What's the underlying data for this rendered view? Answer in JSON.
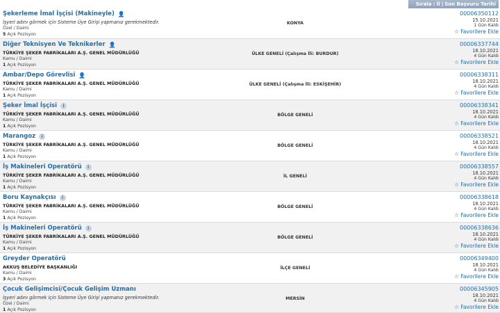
{
  "sort": {
    "label": "Sırala :",
    "option_il": "İl",
    "separator": "|",
    "option_deadline": "Son Başvuru Tarihi"
  },
  "jobs": [
    {
      "title": "Şekerleme İmal İşçisi (Makineyle)",
      "icon": "person-icon",
      "employer": "İşyeri adını görmek için Sisteme Üye Girişi yapmanız gerekmektedir.",
      "employer_hidden": true,
      "type": "Özel / Daimi",
      "positions_count": "5",
      "positions_label": "Açık Pozisyon",
      "location": "KONYA",
      "code": "00006350112",
      "date": "15.10.2021",
      "days_left": "1 Gün Kaldı",
      "fav": "Favorilere Ekle"
    },
    {
      "title": "Diğer Teknisyen Ve Teknikerler",
      "icon": "person-icon",
      "employer": "TÜRKİYE ŞEKER FABRİKALARI A.Ş. GENEL MÜDÜRLÜĞÜ",
      "employer_hidden": false,
      "type": "Kamu / Daimi",
      "positions_count": "1",
      "positions_label": "Açık Pozisyon",
      "location": "ÜLKE GENELİ (Çalışma İli: BURDUR)",
      "code": "00006337744",
      "date": "18.10.2021",
      "days_left": "4 Gün Kaldı",
      "fav": "Favorilere Ekle"
    },
    {
      "title": "Ambar/Depo Görevlisi",
      "icon": "person-icon",
      "employer": "TÜRKİYE ŞEKER FABRİKALARI A.Ş. GENEL MÜDÜRLÜĞÜ",
      "employer_hidden": false,
      "type": "Kamu / Daimi",
      "positions_count": "1",
      "positions_label": "Açık Pozisyon",
      "location": "ÜLKE GENELİ (Çalışma İli: ESKİŞEHİR)",
      "code": "00006338311",
      "date": "18.10.2021",
      "days_left": "4 Gün Kaldı",
      "fav": "Favorilere Ekle"
    },
    {
      "title": "Şeker İmal İşçisi",
      "icon": "info-icon",
      "employer": "TÜRKİYE ŞEKER FABRİKALARI A.Ş. GENEL MÜDÜRLÜĞÜ",
      "employer_hidden": false,
      "type": "Kamu / Daimi",
      "positions_count": "1",
      "positions_label": "Açık Pozisyon",
      "location": "BÖLGE GENELİ",
      "code": "00006338341",
      "date": "18.10.2021",
      "days_left": "4 Gün Kaldı",
      "fav": "Favorilere Ekle"
    },
    {
      "title": "Marangoz",
      "icon": "info-icon",
      "employer": "TÜRKİYE ŞEKER FABRİKALARI A.Ş. GENEL MÜDÜRLÜĞÜ",
      "employer_hidden": false,
      "type": "Kamu / Daimi",
      "positions_count": "1",
      "positions_label": "Açık Pozisyon",
      "location": "BÖLGE GENELİ",
      "code": "00006338521",
      "date": "18.10.2021",
      "days_left": "4 Gün Kaldı",
      "fav": "Favorilere Ekle"
    },
    {
      "title": "İş Makineleri Operatörü",
      "icon": "info-icon",
      "employer": "TÜRKİYE ŞEKER FABRİKALARI A.Ş. GENEL MÜDÜRLÜĞÜ",
      "employer_hidden": false,
      "type": "Kamu / Daimi",
      "positions_count": "1",
      "positions_label": "Açık Pozisyon",
      "location": "İL GENELİ",
      "code": "00006338557",
      "date": "18.10.2021",
      "days_left": "4 Gün Kaldı",
      "fav": "Favorilere Ekle"
    },
    {
      "title": "Boru Kaynakçısı",
      "icon": "info-icon",
      "employer": "TÜRKİYE ŞEKER FABRİKALARI A.Ş. GENEL MÜDÜRLÜĞÜ",
      "employer_hidden": false,
      "type": "Kamu / Daimi",
      "positions_count": "1",
      "positions_label": "Açık Pozisyon",
      "location": "BÖLGE GENELİ",
      "code": "00006338618",
      "date": "18.10.2021",
      "days_left": "4 Gün Kaldı",
      "fav": "Favorilere Ekle"
    },
    {
      "title": "İş Makineleri Operatörü",
      "icon": "info-icon",
      "employer": "TÜRKİYE ŞEKER FABRİKALARI A.Ş. GENEL MÜDÜRLÜĞÜ",
      "employer_hidden": false,
      "type": "Kamu / Daimi",
      "positions_count": "1",
      "positions_label": "Açık Pozisyon",
      "location": "BÖLGE GENELİ",
      "code": "00006338636",
      "date": "18.10.2021",
      "days_left": "4 Gün Kaldı",
      "fav": "Favorilere Ekle"
    },
    {
      "title": "Greyder Operatörü",
      "icon": "",
      "employer": "AKKUŞ BELEDİYE BAŞKANLIĞI",
      "employer_hidden": false,
      "type": "Kamu / Daimi",
      "positions_count": "3",
      "positions_label": "Açık Pozisyon",
      "location": "İLÇE GENELİ",
      "code": "00006349400",
      "date": "18.10.2021",
      "days_left": "4 Gün Kaldı",
      "fav": "Favorilere Ekle"
    },
    {
      "title": "Çocuk Gelişimcisi/Çocuk Gelişim Uzmanı",
      "icon": "",
      "employer": "İşyeri adını görmek için Sisteme Üye Girişi yapmanız gerekmektedir.",
      "employer_hidden": true,
      "type": "Özel / Daimi",
      "positions_count": "1",
      "positions_label": "Açık Pozisyon",
      "location": "MERSİN",
      "code": "00006345905",
      "date": "18.10.2021",
      "days_left": "4 Gün Kaldı",
      "fav": "Favorilere Ekle"
    }
  ]
}
